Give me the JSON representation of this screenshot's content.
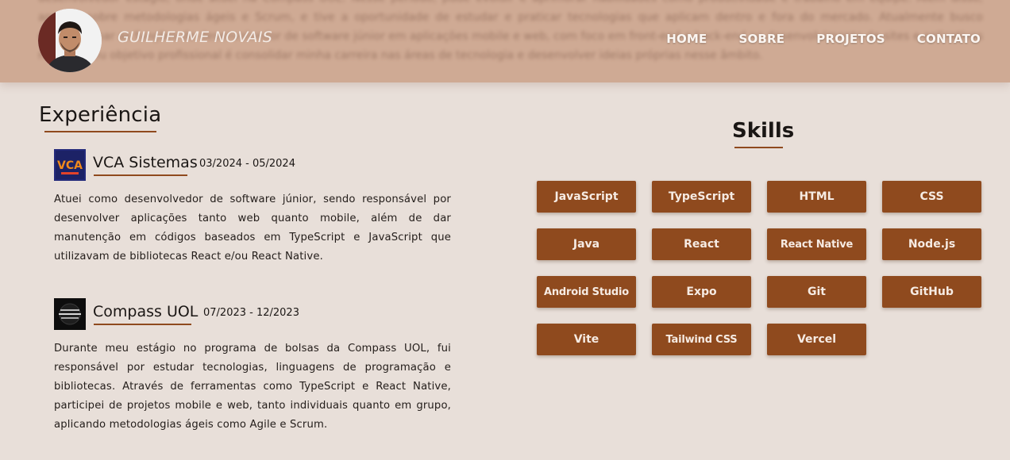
{
  "header": {
    "brand": "GUILHERME NOVAIS",
    "nav": [
      "HOME",
      "SOBRE",
      "PROJETOS",
      "CONTATO"
    ],
    "background_text": "desenvolvedor estágio, onde atuei na Compass UOL. Nesse período, pude evoluir e aprimorar habilidades como produtividade e trabalho em equipe. Além disso, aprendi sobre metodologias ágeis e Scrum, e tive a oportunidade de estudar e praticar tecnologias que aplicam dentro e fora do mercado. Atualmente busco desempenhar as funções de desenvolvedor de software júnior em aplicações mobile e web, com foco em front-end e back-end no desenvolvimento de sites e aplicativos mobile. Meu objetivo profissional é consolidar minha carreira nas áreas de tecnologia e desenvolver ideias próprias nesse âmbito."
  },
  "experience": {
    "title": "Experiência",
    "jobs": [
      {
        "company": "VCA Sistemas",
        "dates": "03/2024 - 05/2024",
        "logo_icon": "vca-logo-icon",
        "description": "Atuei como desenvolvedor de software júnior, sendo responsável por desenvolver aplicações tanto web quanto mobile, além de dar manutenção em códigos baseados em TypeScript e JavaScript que utilizavam de bibliotecas React e/ou React Native."
      },
      {
        "company": "Compass UOL",
        "dates": "07/2023 - 12/2023",
        "logo_icon": "compass-uol-logo-icon",
        "description": "Durante meu estágio no programa de bolsas da Compass UOL, fui responsável por estudar tecnologias, linguagens de programação e bibliotecas. Através de ferramentas como TypeScript e React Native, participei de projetos mobile e web, tanto individuais quanto em grupo, aplicando metodologias ágeis como Agile e Scrum."
      }
    ]
  },
  "skills": {
    "title": "Skills",
    "items": [
      "JavaScript",
      "TypeScript",
      "HTML",
      "CSS",
      "Java",
      "React",
      "React Native",
      "Node.js",
      "Android Studio",
      "Expo",
      "Git",
      "GitHub",
      "Vite",
      "Tailwind CSS",
      "Vercel"
    ]
  },
  "colors": {
    "accent": "#8f4a1e",
    "background": "#e8dfd9",
    "header": "#cfaa94"
  }
}
